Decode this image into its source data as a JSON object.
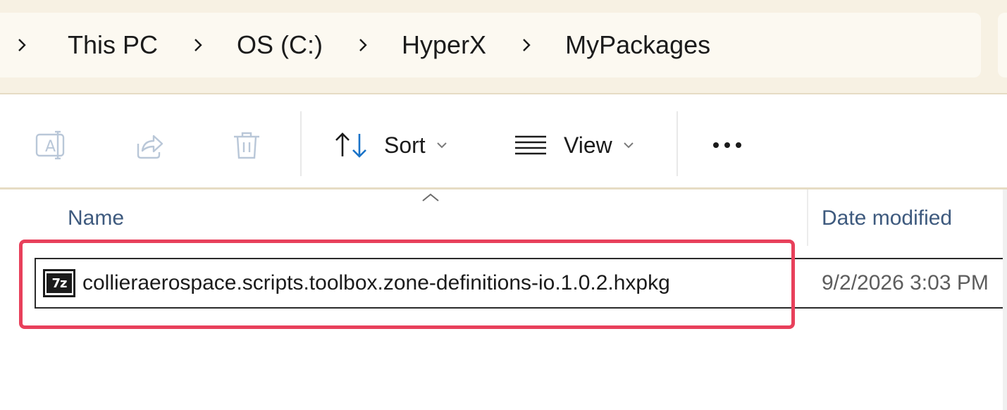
{
  "breadcrumb": {
    "items": [
      "This PC",
      "OS (C:)",
      "HyperX",
      "MyPackages"
    ]
  },
  "toolbar": {
    "rename_icon": "rename-icon",
    "share_icon": "share-icon",
    "delete_icon": "delete-icon",
    "sort_label": "Sort",
    "view_label": "View",
    "more_icon": "more-options-icon"
  },
  "file_list": {
    "columns": [
      "Name",
      "Date modified"
    ],
    "sort_direction": "ascending",
    "rows": [
      {
        "name": "collieraerospace.scripts.toolbox.zone-definitions-io.1.0.2.hxpkg",
        "date_modified": "9/2/2026 3:03 PM",
        "icon": "7z-archive-icon",
        "icon_text": "7z"
      }
    ]
  },
  "colors": {
    "highlight": "#e8405b",
    "header_text": "#3e5a7e",
    "background_band": "#f7f1e3"
  }
}
